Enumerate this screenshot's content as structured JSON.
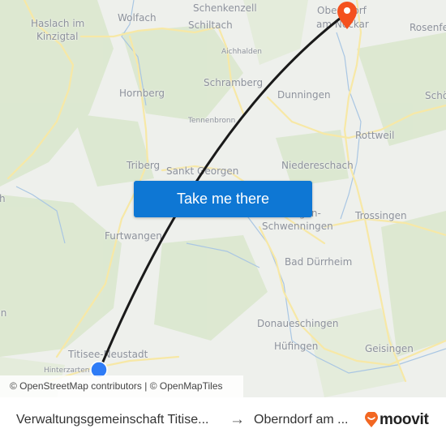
{
  "map": {
    "places": [
      {
        "name": "Haslach im",
        "size": "normal"
      },
      {
        "name": "Kinzigtal",
        "size": "normal"
      },
      {
        "name": "Wolfach",
        "size": "normal"
      },
      {
        "name": "Schenkenzell",
        "size": "normal"
      },
      {
        "name": "Schiltach",
        "size": "normal"
      },
      {
        "name": "Aichhalden",
        "size": "small"
      },
      {
        "name": "Oberndorf",
        "size": "normal"
      },
      {
        "name": "am Neckar",
        "size": "normal"
      },
      {
        "name": "Rosenfeld",
        "size": "normal"
      },
      {
        "name": "Hornberg",
        "size": "normal"
      },
      {
        "name": "Schramberg",
        "size": "normal"
      },
      {
        "name": "Dunningen",
        "size": "normal"
      },
      {
        "name": "Schömberg",
        "size": "normal"
      },
      {
        "name": "Tennenbronn",
        "size": "small"
      },
      {
        "name": "Rottweil",
        "size": "normal"
      },
      {
        "name": "Triberg",
        "size": "normal"
      },
      {
        "name": "Sankt Georgen",
        "size": "normal"
      },
      {
        "name": "Niedereschach",
        "size": "normal"
      },
      {
        "name": "Villingen-",
        "size": "normal"
      },
      {
        "name": "Schwenningen",
        "size": "normal"
      },
      {
        "name": "Trossingen",
        "size": "normal"
      },
      {
        "name": "Furtwangen",
        "size": "normal"
      },
      {
        "name": "Bad Dürrheim",
        "size": "normal"
      },
      {
        "name": "Donaueschingen",
        "size": "normal"
      },
      {
        "name": "Titisee-Neustadt",
        "size": "normal"
      },
      {
        "name": "Hinterzarten",
        "size": "small"
      },
      {
        "name": "Hüfingen",
        "size": "normal"
      },
      {
        "name": "Geisingen",
        "size": "normal"
      },
      {
        "name": "Waldkirch",
        "size": "normal"
      },
      {
        "name": "Kirchzarten",
        "size": "normal"
      }
    ],
    "origin_marker_color": "#2f7cf6",
    "destination_marker_color": "#f4511e",
    "route_color": "#1a1a1a"
  },
  "cta": {
    "label": "Take me there",
    "color": "#0e77d4"
  },
  "attribution": {
    "osm": "© OpenStreetMap contributors",
    "separator": "|",
    "omt": "© OpenMapTiles"
  },
  "footer": {
    "from": "Verwaltungsgemeinschaft Titise...",
    "arrow": "→",
    "to": "Oberndorf am ...",
    "brand": "moovit",
    "brand_color": "#f26722"
  }
}
